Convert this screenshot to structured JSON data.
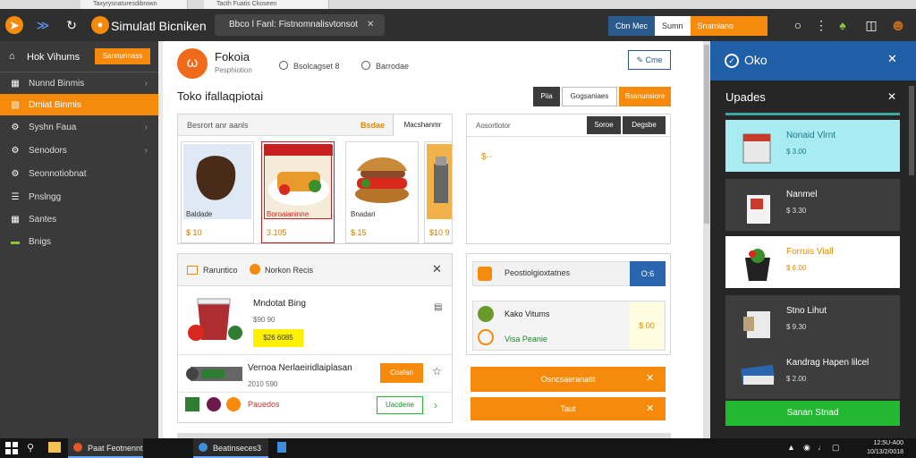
{
  "tabs": [
    {
      "label": "Taxyrysnaturesdibrown"
    },
    {
      "label": "Tacth Fuatis Ckoseen"
    }
  ],
  "toolbar": {
    "app_title": "Simulatl Bicniken",
    "url": "Bbco l Fanl: Fistnomnalisvtonsot",
    "right_buttons": [
      "Cbn Mec",
      "Sumn",
      "Snamiano"
    ]
  },
  "sidebar": {
    "header": "Hok Vihums",
    "header_button": "Sannunnass",
    "items": [
      {
        "label": "Nunnd Binmis",
        "icon": "calendar-icon"
      },
      {
        "label": "Dmiat Binmis",
        "icon": "folder-icon"
      },
      {
        "label": "Syshn Faua",
        "icon": "gear-icon"
      },
      {
        "label": "Senodors",
        "icon": "settings-icon"
      },
      {
        "label": "Seonnotiobnat",
        "icon": "settings-icon"
      },
      {
        "label": "Pnslngg",
        "icon": "list-icon"
      },
      {
        "label": "Santes",
        "icon": "grid-icon"
      },
      {
        "label": "Bnigs",
        "icon": "box-icon"
      }
    ]
  },
  "main": {
    "logo_title": "Fokoia",
    "logo_sub": "Pesphiotion",
    "radio1": "Bsolcagset 8",
    "radio2": "Barrodae",
    "corner_button": "Cme",
    "section_title": "Toko ifallaqpiotai",
    "filter_buttons": [
      "Piia",
      "Gogsaniaes",
      "Bsanunsiore"
    ],
    "products_header": "Besrort anr aanls",
    "products_header_tag": "Bsdae",
    "products_header_btn": "Macshanmr",
    "products": [
      {
        "name": "Baldade",
        "price": "$ 10"
      },
      {
        "name": "Boroaianinne",
        "price": "3.105"
      },
      {
        "name": "Bnadari",
        "price": "$.15"
      },
      {
        "name": "",
        "price": "$10 9"
      }
    ],
    "details_header": "Aosortlotor",
    "details_btns": [
      "Soroe",
      "Degsbe"
    ],
    "details_note": "$··",
    "cart_header": "Raruntico",
    "cart_sub": "Norkon Recis",
    "cart_items": [
      {
        "title": "Mndotat Bing",
        "price": "$90 90",
        "badge": "$26 6085"
      },
      {
        "title": "Vernoa Nerlaeiridlaiplasan",
        "price": "2010 590",
        "action": "Coafan"
      }
    ],
    "cart_footer_label": "Pauedos",
    "cart_footer_btn": "Uacdene",
    "promo_title": "Peostiolgioxtatnes",
    "promo_btn": "O:6",
    "promo_line1": "Kako Vitums",
    "promo_line2": "Visa Peanie",
    "promo_value": "$ 00",
    "action1": "Osncsaeranatit",
    "action2": "Taut"
  },
  "rpanel": {
    "title": "Oko",
    "subtitle": "Upades",
    "items": [
      {
        "title": "Nonaid Vlrnt",
        "price": "$ 3.00"
      },
      {
        "title": "Nanmel",
        "price": "$ 3.30"
      },
      {
        "title": "Forruis Viall",
        "price": "$ 6.00"
      },
      {
        "title": "Stno Lihut",
        "price": "$ 9.30"
      },
      {
        "title": "Kandrag Hapen lilcel",
        "price": "$ 2.00"
      }
    ],
    "cta": "Sanan Stnad"
  },
  "taskbar": {
    "items": [
      "Paat Feotnennt",
      "Beatinseces3"
    ],
    "clock": "12:5U-A00\n10/13/2/0018"
  },
  "colors": {
    "accent": "#f58a0c",
    "dark": "#2f2f2f",
    "blue": "#1f5fa8",
    "green": "#22b830"
  }
}
